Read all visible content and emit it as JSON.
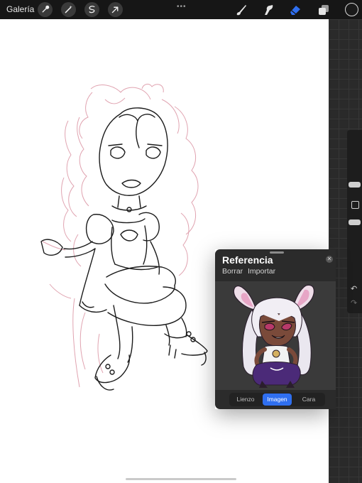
{
  "toolbar": {
    "gallery_label": "Galería",
    "drag_handle": "•••",
    "left_tools": [
      "wrench-icon",
      "magic-wand-icon",
      "selection-icon",
      "transform-arrow-icon"
    ],
    "right_tools": [
      "brush-icon",
      "smudge-icon",
      "eraser-icon",
      "layers-icon"
    ],
    "active_tool": "eraser-icon",
    "accent_color": "#2f6ff0",
    "current_color": "#1a1a1a"
  },
  "sidebar": {
    "undo_glyph": "↶",
    "redo_glyph": "↷"
  },
  "reference": {
    "title": "Referencia",
    "close_glyph": "✕",
    "actions": {
      "clear": "Borrar",
      "import": "Importar"
    },
    "segments": {
      "canvas": "Lienzo",
      "image": "Imagen",
      "face": "Cara"
    },
    "active_segment": "Imagen"
  }
}
